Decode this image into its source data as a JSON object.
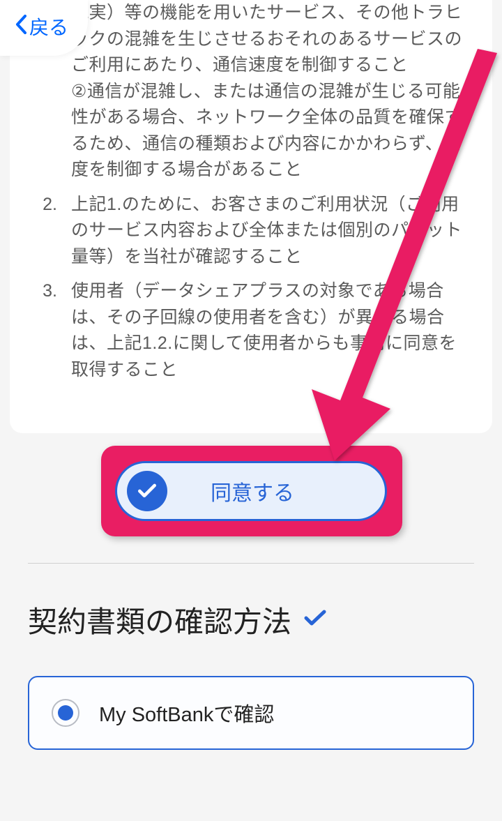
{
  "back_button": {
    "label": "戻る"
  },
  "terms_list": {
    "items": [
      {
        "number": "",
        "text": "現実）等の機能を用いたサービス、その他トラヒックの混雑を生じさせるおそれのあるサービスのご利用にあたり、通信速度を制御すること\n②通信が混雑し、または通信の混雑が生じる可能性がある場合、ネットワーク全体の品質を確保するため、通信の種類および内容にかかわらず、速度を制御する場合があること"
      },
      {
        "number": "2.",
        "text": "上記1.のために、お客さまのご利用状況（ご利用のサービス内容および全体または個別のパケット量等）を当社が確認すること"
      },
      {
        "number": "3.",
        "text": "使用者（データシェアプラスの対象である場合は、その子回線の使用者を含む）が異なる場合は、上記1.2.に関して使用者からも事前に同意を取得すること"
      }
    ]
  },
  "agree_button": {
    "label": "同意する"
  },
  "confirmation_section": {
    "title": "契約書類の確認方法",
    "options": [
      {
        "label": "My SoftBankで確認",
        "selected": true
      }
    ]
  },
  "colors": {
    "primary": "#2764d6",
    "highlight": "#e91e63"
  }
}
